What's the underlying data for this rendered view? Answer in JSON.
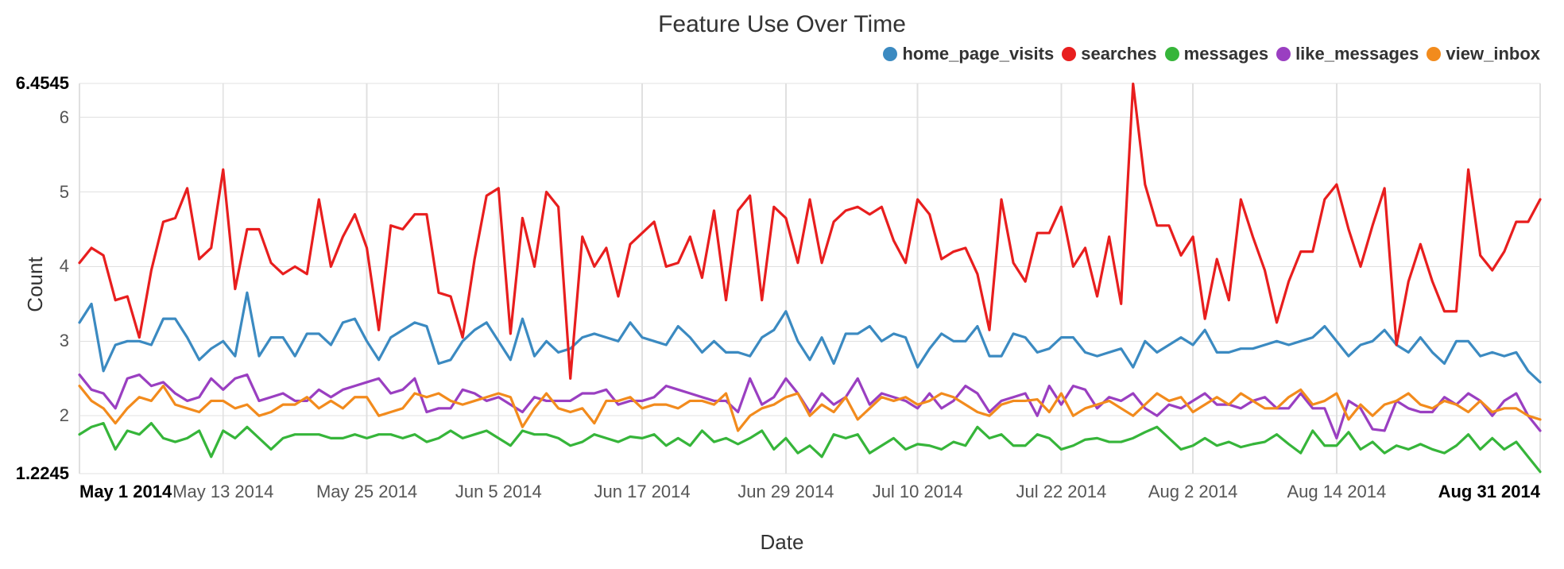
{
  "chart_data": {
    "type": "line",
    "title": "Feature Use Over Time",
    "xlabel": "Date",
    "ylabel": "Count",
    "ylim": [
      1.2245,
      6.4545
    ],
    "y_ticks": [
      2,
      3,
      4,
      5,
      6
    ],
    "y_extremes": {
      "min_label": "1.2245",
      "max_label": "6.4545"
    },
    "x_extremes": {
      "first": "May 1 2014",
      "last": "Aug 31 2014"
    },
    "x_tick_labels": [
      "May 13 2014",
      "May 25 2014",
      "Jun 5 2014",
      "Jun 17 2014",
      "Jun 29 2014",
      "Jul 10 2014",
      "Jul 22 2014",
      "Aug 2 2014",
      "Aug 14 2014"
    ],
    "x_tick_indices": [
      12,
      24,
      35,
      47,
      59,
      70,
      82,
      93,
      105
    ],
    "n_points": 123,
    "legend": [
      {
        "name": "home_page_visits",
        "color": "#3b8ac1"
      },
      {
        "name": "searches",
        "color": "#e81e1e"
      },
      {
        "name": "messages",
        "color": "#36b53a"
      },
      {
        "name": "like_messages",
        "color": "#9a3fc1"
      },
      {
        "name": "view_inbox",
        "color": "#f28b1d"
      }
    ],
    "series": [
      {
        "name": "home_page_visits",
        "color": "#3b8ac1",
        "values": [
          3.25,
          3.5,
          2.6,
          2.95,
          3.0,
          3.0,
          2.95,
          3.3,
          3.3,
          3.05,
          2.75,
          2.9,
          3.0,
          2.8,
          3.65,
          2.8,
          3.05,
          3.05,
          2.8,
          3.1,
          3.1,
          2.95,
          3.25,
          3.3,
          3.0,
          2.75,
          3.05,
          3.15,
          3.25,
          3.2,
          2.7,
          2.75,
          3.0,
          3.15,
          3.25,
          3.0,
          2.75,
          3.3,
          2.8,
          3.0,
          2.85,
          2.9,
          3.05,
          3.1,
          3.05,
          3.0,
          3.25,
          3.05,
          3.0,
          2.95,
          3.2,
          3.05,
          2.85,
          3.0,
          2.85,
          2.85,
          2.8,
          3.05,
          3.15,
          3.4,
          3.0,
          2.75,
          3.05,
          2.7,
          3.1,
          3.1,
          3.2,
          3.0,
          3.1,
          3.05,
          2.65,
          2.9,
          3.1,
          3.0,
          3.0,
          3.2,
          2.8,
          2.8,
          3.1,
          3.05,
          2.85,
          2.9,
          3.05,
          3.05,
          2.85,
          2.8,
          2.85,
          2.9,
          2.65,
          3.0,
          2.85,
          2.95,
          3.05,
          2.95,
          3.15,
          2.85,
          2.85,
          2.9,
          2.9,
          2.95,
          3.0,
          2.95,
          3.0,
          3.05,
          3.2,
          3.0,
          2.8,
          2.95,
          3.0,
          3.15,
          2.95,
          2.85,
          3.05,
          2.85,
          2.7,
          3.0,
          3.0,
          2.8,
          2.85,
          2.8,
          2.85,
          2.6,
          2.45
        ]
      },
      {
        "name": "searches",
        "color": "#e81e1e",
        "values": [
          4.05,
          4.25,
          4.15,
          3.55,
          3.6,
          3.05,
          3.95,
          4.6,
          4.65,
          5.05,
          4.1,
          4.25,
          5.3,
          3.7,
          4.5,
          4.5,
          4.05,
          3.9,
          4.0,
          3.9,
          4.9,
          4.0,
          4.4,
          4.7,
          4.25,
          3.15,
          4.55,
          4.5,
          4.7,
          4.7,
          3.65,
          3.6,
          3.05,
          4.1,
          4.95,
          5.05,
          3.1,
          4.65,
          4.0,
          5.0,
          4.8,
          2.5,
          4.4,
          4.0,
          4.25,
          3.6,
          4.3,
          4.45,
          4.6,
          4.0,
          4.05,
          4.4,
          3.85,
          4.75,
          3.55,
          4.75,
          4.95,
          3.55,
          4.8,
          4.65,
          4.05,
          4.9,
          4.05,
          4.6,
          4.75,
          4.8,
          4.7,
          4.8,
          4.35,
          4.05,
          4.9,
          4.7,
          4.1,
          4.2,
          4.25,
          3.9,
          3.15,
          4.9,
          4.05,
          3.8,
          4.45,
          4.45,
          4.8,
          4.0,
          4.25,
          3.6,
          4.4,
          3.5,
          6.45,
          5.1,
          4.55,
          4.55,
          4.15,
          4.4,
          3.3,
          4.1,
          3.55,
          4.9,
          4.4,
          3.95,
          3.25,
          3.8,
          4.2,
          4.2,
          4.9,
          5.1,
          4.5,
          4.0,
          4.55,
          5.05,
          2.95,
          3.8,
          4.3,
          3.8,
          3.4,
          3.4,
          5.3,
          4.15,
          3.95,
          4.2,
          4.6,
          4.6,
          4.9
        ]
      },
      {
        "name": "messages",
        "color": "#36b53a",
        "values": [
          1.75,
          1.85,
          1.9,
          1.55,
          1.8,
          1.75,
          1.9,
          1.7,
          1.65,
          1.7,
          1.8,
          1.45,
          1.8,
          1.7,
          1.85,
          1.7,
          1.55,
          1.7,
          1.75,
          1.75,
          1.75,
          1.7,
          1.7,
          1.75,
          1.7,
          1.75,
          1.75,
          1.7,
          1.75,
          1.65,
          1.7,
          1.8,
          1.7,
          1.75,
          1.8,
          1.7,
          1.6,
          1.8,
          1.75,
          1.75,
          1.7,
          1.6,
          1.65,
          1.75,
          1.7,
          1.65,
          1.72,
          1.7,
          1.75,
          1.6,
          1.7,
          1.6,
          1.8,
          1.65,
          1.7,
          1.62,
          1.7,
          1.8,
          1.55,
          1.7,
          1.5,
          1.6,
          1.45,
          1.75,
          1.7,
          1.75,
          1.5,
          1.6,
          1.7,
          1.55,
          1.62,
          1.6,
          1.55,
          1.65,
          1.6,
          1.85,
          1.7,
          1.75,
          1.6,
          1.6,
          1.75,
          1.7,
          1.55,
          1.6,
          1.68,
          1.7,
          1.65,
          1.65,
          1.7,
          1.78,
          1.85,
          1.7,
          1.55,
          1.6,
          1.7,
          1.6,
          1.65,
          1.58,
          1.62,
          1.65,
          1.75,
          1.62,
          1.5,
          1.8,
          1.6,
          1.6,
          1.78,
          1.55,
          1.65,
          1.5,
          1.6,
          1.55,
          1.62,
          1.55,
          1.5,
          1.6,
          1.75,
          1.55,
          1.7,
          1.55,
          1.65,
          1.45,
          1.25
        ]
      },
      {
        "name": "like_messages",
        "color": "#9a3fc1",
        "values": [
          2.55,
          2.35,
          2.3,
          2.1,
          2.5,
          2.55,
          2.4,
          2.45,
          2.3,
          2.2,
          2.25,
          2.5,
          2.35,
          2.5,
          2.55,
          2.2,
          2.25,
          2.3,
          2.2,
          2.2,
          2.35,
          2.25,
          2.35,
          2.4,
          2.45,
          2.5,
          2.3,
          2.35,
          2.5,
          2.05,
          2.1,
          2.1,
          2.35,
          2.3,
          2.2,
          2.25,
          2.15,
          2.05,
          2.25,
          2.2,
          2.2,
          2.2,
          2.3,
          2.3,
          2.35,
          2.15,
          2.2,
          2.2,
          2.25,
          2.4,
          2.35,
          2.3,
          2.25,
          2.2,
          2.2,
          2.05,
          2.5,
          2.15,
          2.25,
          2.5,
          2.3,
          2.05,
          2.3,
          2.15,
          2.25,
          2.5,
          2.15,
          2.3,
          2.25,
          2.2,
          2.1,
          2.3,
          2.1,
          2.2,
          2.4,
          2.3,
          2.05,
          2.2,
          2.25,
          2.3,
          2.0,
          2.4,
          2.15,
          2.4,
          2.35,
          2.1,
          2.25,
          2.2,
          2.3,
          2.1,
          2.0,
          2.15,
          2.1,
          2.2,
          2.3,
          2.15,
          2.15,
          2.1,
          2.2,
          2.25,
          2.1,
          2.1,
          2.3,
          2.1,
          2.1,
          1.7,
          2.2,
          2.1,
          1.82,
          1.8,
          2.2,
          2.1,
          2.05,
          2.05,
          2.25,
          2.15,
          2.3,
          2.2,
          2.0,
          2.2,
          2.3,
          2.0,
          1.8
        ]
      },
      {
        "name": "view_inbox",
        "color": "#f28b1d",
        "values": [
          2.4,
          2.2,
          2.1,
          1.9,
          2.1,
          2.25,
          2.2,
          2.4,
          2.15,
          2.1,
          2.05,
          2.2,
          2.2,
          2.1,
          2.15,
          2.0,
          2.05,
          2.15,
          2.15,
          2.25,
          2.1,
          2.2,
          2.1,
          2.25,
          2.25,
          2.0,
          2.05,
          2.1,
          2.3,
          2.25,
          2.3,
          2.2,
          2.15,
          2.2,
          2.25,
          2.3,
          2.25,
          1.85,
          2.1,
          2.3,
          2.1,
          2.05,
          2.1,
          1.9,
          2.2,
          2.2,
          2.25,
          2.1,
          2.15,
          2.15,
          2.1,
          2.2,
          2.2,
          2.15,
          2.3,
          1.8,
          2.0,
          2.1,
          2.15,
          2.25,
          2.3,
          2.0,
          2.15,
          2.05,
          2.25,
          1.95,
          2.1,
          2.25,
          2.2,
          2.25,
          2.15,
          2.2,
          2.3,
          2.25,
          2.15,
          2.05,
          2.0,
          2.15,
          2.2,
          2.2,
          2.22,
          2.05,
          2.3,
          2.0,
          2.1,
          2.15,
          2.2,
          2.1,
          2.0,
          2.15,
          2.3,
          2.2,
          2.25,
          2.05,
          2.15,
          2.25,
          2.15,
          2.3,
          2.2,
          2.1,
          2.1,
          2.25,
          2.35,
          2.15,
          2.2,
          2.3,
          1.95,
          2.15,
          2.0,
          2.15,
          2.2,
          2.3,
          2.15,
          2.1,
          2.2,
          2.15,
          2.05,
          2.2,
          2.05,
          2.1,
          2.1,
          2.0,
          1.95
        ]
      }
    ]
  }
}
